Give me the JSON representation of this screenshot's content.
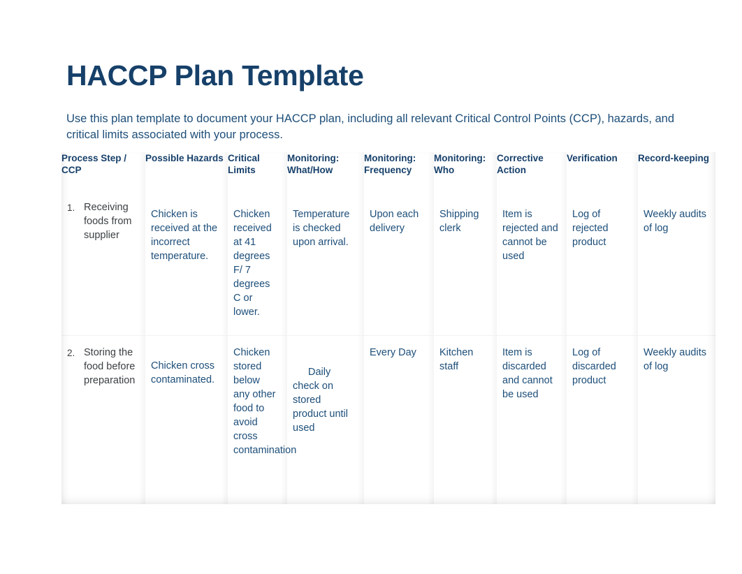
{
  "document": {
    "title": "HACCP Plan Template",
    "subtitle": "Use this plan template to document your HACCP plan, including all relevant Critical Control Points (CCP), hazards, and critical limits associated with your process."
  },
  "colors": {
    "title_navy": "#164069",
    "body_navy": "#1d4e79",
    "header_navy": "#17406a",
    "step_gray": "#3c4043",
    "page_background": "#ffffff"
  },
  "table": {
    "headers": [
      "Process Step / CCP",
      "Possible Hazards",
      "Critical Limits",
      "Monitoring: What/How",
      "Monitoring: Frequency",
      "Monitoring: Who",
      "Corrective Action",
      "Verification",
      "Record-keeping"
    ],
    "rows": [
      {
        "number": "1.",
        "process_step": "Receiving foods from supplier",
        "possible_hazards": "Chicken is received at the incorrect temperature.",
        "critical_limits": "Chicken received at 41 degrees F/ 7 degrees C or lower.",
        "monitoring_what_how": "Temperature is checked upon arrival.",
        "monitoring_frequency": "Upon each delivery",
        "monitoring_who": "Shipping clerk",
        "corrective_action": "Item is rejected and cannot be used",
        "verification": "Log of rejected product",
        "record_keeping": "Weekly audits of log"
      },
      {
        "number": "2.",
        "process_step": "Storing the food before preparation",
        "possible_hazards": "Chicken cross contaminated.",
        "critical_limits": "Chicken stored below any other food to avoid cross contamination",
        "monitoring_what_how": "Daily check on stored product until used",
        "monitoring_frequency": "Every Day",
        "monitoring_who": "Kitchen staff",
        "corrective_action": "Item is discarded and cannot be used",
        "verification": "Log of discarded product",
        "record_keeping": "Weekly audits of log"
      }
    ]
  }
}
